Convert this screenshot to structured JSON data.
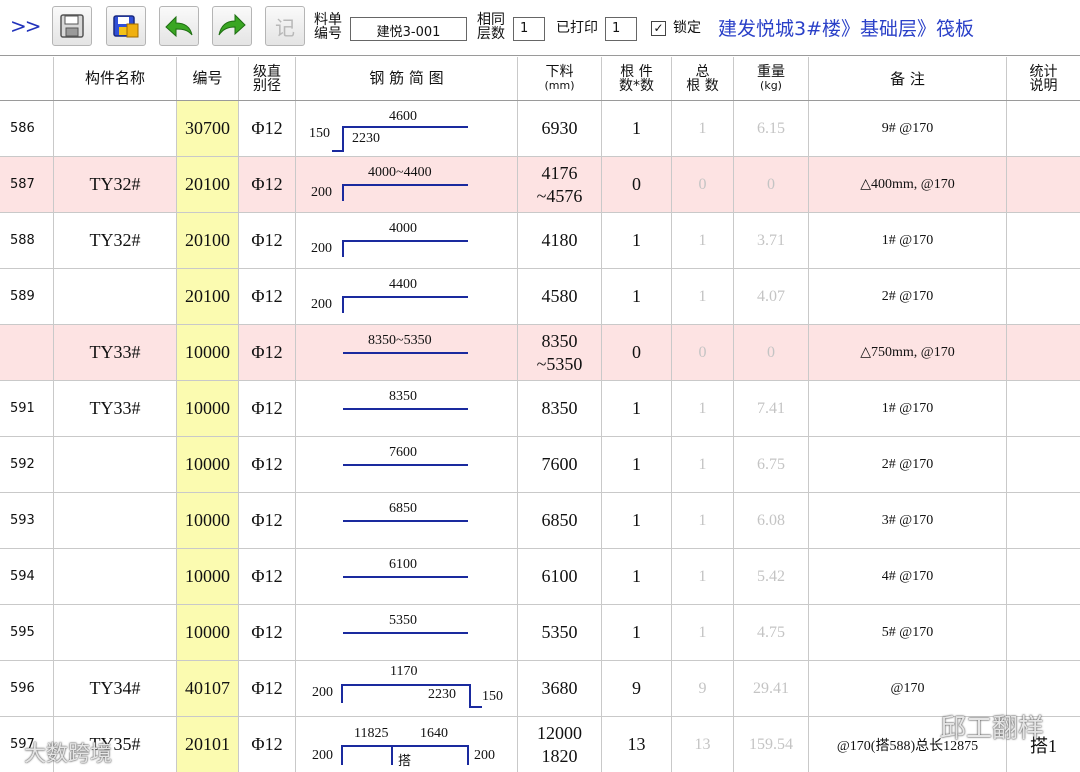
{
  "toolbar": {
    "more_label": ">>",
    "record_label": "记",
    "material_code_label": "料单编号",
    "material_code_value": "建悦3-001",
    "same_layers_label": "相同层数",
    "same_layers_value": "1",
    "printed_label": "已打印",
    "printed_value": "1",
    "locked_label": "锁定",
    "locked_check": "✓",
    "path": "建发悦城3#楼》基础层》筏板"
  },
  "columns": {
    "component_name": "构件名称",
    "code": "编号",
    "grade_diameter_a": "级直",
    "grade_diameter_b": "别径",
    "sketch": "钢 筋 简 图",
    "cut_length_a": "下料",
    "cut_length_b": "(mm)",
    "count_a": "根 件",
    "count_b": "数*数",
    "total_a": "总",
    "total_b": "根 数",
    "weight_a": "重量",
    "weight_b": "(kg)",
    "remark": "备 注",
    "stats_a": "统计",
    "stats_b": "说明"
  },
  "rows": [
    {
      "no": "586",
      "name": "",
      "code": "30700",
      "spec": "Φ12",
      "len1": "6930",
      "len2": "",
      "count": "1",
      "total": "1",
      "weight": "6.15",
      "remark": "9# @170",
      "stats": "",
      "shape": {
        "top": "4600",
        "left": "150",
        "bottom": "2230"
      }
    },
    {
      "no": "587",
      "name": "TY32#",
      "code": "20100",
      "spec": "Φ12",
      "len1": "4176",
      "len2": "~4576",
      "count": "0",
      "total": "0",
      "weight": "0",
      "remark": "△400mm, @170",
      "stats": "",
      "shape": {
        "top": "4000~4400",
        "left": "200"
      }
    },
    {
      "no": "588",
      "name": "TY32#",
      "code": "20100",
      "spec": "Φ12",
      "len1": "4180",
      "len2": "",
      "count": "1",
      "total": "1",
      "weight": "3.71",
      "remark": "1# @170",
      "stats": "",
      "shape": {
        "top": "4000",
        "left": "200"
      }
    },
    {
      "no": "589",
      "name": "",
      "code": "20100",
      "spec": "Φ12",
      "len1": "4580",
      "len2": "",
      "count": "1",
      "total": "1",
      "weight": "4.07",
      "remark": "2# @170",
      "stats": "",
      "shape": {
        "top": "4400",
        "left": "200"
      }
    },
    {
      "no": "",
      "name": "TY33#",
      "code": "10000",
      "spec": "Φ12",
      "len1": "8350",
      "len2": "~5350",
      "count": "0",
      "total": "0",
      "weight": "0",
      "remark": "△750mm, @170",
      "stats": "",
      "shape": {
        "top": "8350~5350"
      }
    },
    {
      "no": "591",
      "name": "TY33#",
      "code": "10000",
      "spec": "Φ12",
      "len1": "8350",
      "len2": "",
      "count": "1",
      "total": "1",
      "weight": "7.41",
      "remark": "1# @170",
      "stats": "",
      "shape": {
        "top": "8350"
      }
    },
    {
      "no": "592",
      "name": "",
      "code": "10000",
      "spec": "Φ12",
      "len1": "7600",
      "len2": "",
      "count": "1",
      "total": "1",
      "weight": "6.75",
      "remark": "2# @170",
      "stats": "",
      "shape": {
        "top": "7600"
      }
    },
    {
      "no": "593",
      "name": "",
      "code": "10000",
      "spec": "Φ12",
      "len1": "6850",
      "len2": "",
      "count": "1",
      "total": "1",
      "weight": "6.08",
      "remark": "3# @170",
      "stats": "",
      "shape": {
        "top": "6850"
      }
    },
    {
      "no": "594",
      "name": "",
      "code": "10000",
      "spec": "Φ12",
      "len1": "6100",
      "len2": "",
      "count": "1",
      "total": "1",
      "weight": "5.42",
      "remark": "4# @170",
      "stats": "",
      "shape": {
        "top": "6100"
      }
    },
    {
      "no": "595",
      "name": "",
      "code": "10000",
      "spec": "Φ12",
      "len1": "5350",
      "len2": "",
      "count": "1",
      "total": "1",
      "weight": "4.75",
      "remark": "5# @170",
      "stats": "",
      "shape": {
        "top": "5350"
      }
    },
    {
      "no": "596",
      "name": "TY34#",
      "code": "40107",
      "spec": "Φ12",
      "len1": "3680",
      "len2": "",
      "count": "9",
      "total": "9",
      "weight": "29.41",
      "remark": "@170",
      "stats": "",
      "shape": {
        "top": "1170",
        "left": "200",
        "mid": "2230",
        "right": "150"
      }
    },
    {
      "no": "597",
      "name": "TY35#",
      "code": "20101",
      "spec": "Φ12",
      "len1": "12000",
      "len2": "1820",
      "count": "13",
      "total": "13",
      "weight": "159.54",
      "remark": "@170(搭588)总长12875",
      "stats": "搭1",
      "shape": {
        "top": "11825",
        "top2": "1640",
        "left": "200",
        "right": "200",
        "lap": "搭"
      }
    }
  ],
  "watermarks": {
    "bottom_left": "大数跨境",
    "bottom_right": "邱工翻样"
  },
  "colors": {
    "pink_row": "#fde3e3",
    "code_highlight": "#fbfbb0",
    "rebar_line": "#1a2a9e",
    "path_text": "#2a40c8",
    "muted_text": "#c4c4c4"
  }
}
